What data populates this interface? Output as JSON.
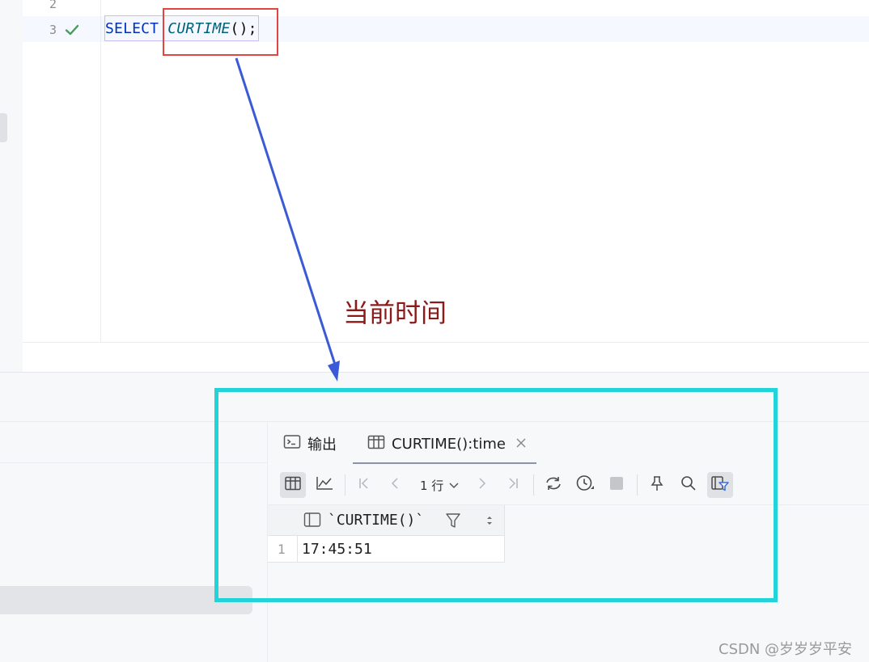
{
  "editor": {
    "line_numbers": [
      "2",
      "3"
    ],
    "code": {
      "keyword": "SELECT",
      "function": "CURTIME",
      "suffix": "();"
    }
  },
  "annotation": {
    "label": "当前时间"
  },
  "results": {
    "tabs": [
      {
        "label": "输出",
        "icon": "terminal-icon"
      },
      {
        "label": "CURTIME():time",
        "icon": "table-icon",
        "active": true
      }
    ],
    "toolbar": {
      "rows_label": "1 行"
    },
    "grid": {
      "columns": [
        "`CURTIME()`"
      ],
      "rows": [
        {
          "row_no": "1",
          "values": [
            "17:45:51"
          ]
        }
      ]
    }
  },
  "watermark": "CSDN @岁岁岁平安",
  "colors": {
    "keyword": "#0033b3",
    "function": "#00627a",
    "highlight_red": "#e0463f",
    "highlight_cyan": "#22d3d9",
    "arrow": "#3b5bd6",
    "annotation": "#8b1a1a",
    "success_check": "#4a9a5c"
  }
}
